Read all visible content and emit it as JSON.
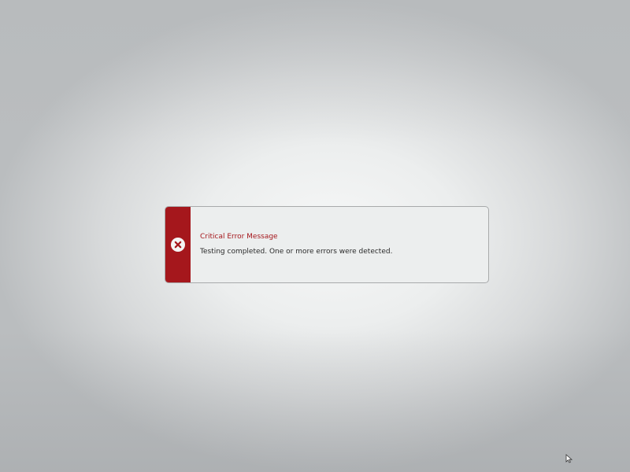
{
  "dialog": {
    "title": "Critical Error Message",
    "message": "Testing completed. One or more errors were detected.",
    "icon": "error-x-circle-icon",
    "accent_color": "#a5171c"
  },
  "cursor": {
    "icon": "mouse-pointer-icon"
  }
}
